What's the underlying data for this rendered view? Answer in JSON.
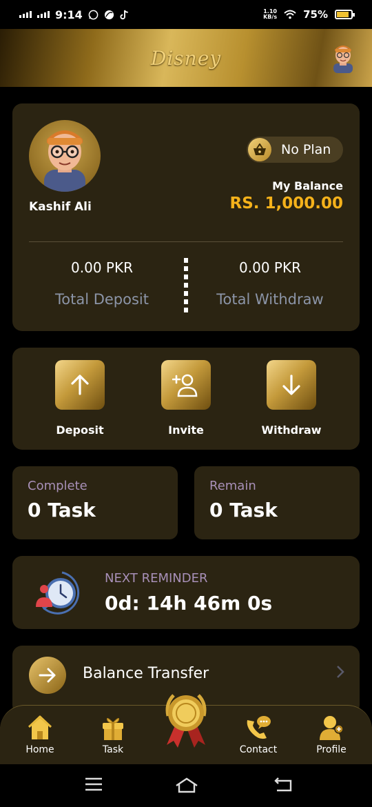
{
  "status_bar": {
    "time": "9:14",
    "net_speed_top": "1.10",
    "net_speed_bottom": "KB/s",
    "battery": "75%",
    "battery_level": 0.75
  },
  "header": {
    "logo_text": "Disney"
  },
  "profile": {
    "user_name": "Kashif Ali",
    "plan_label": "No Plan",
    "balance_label": "My Balance",
    "balance_value": "RS. 1,000.00",
    "deposit_value": "0.00 PKR",
    "deposit_label": "Total Deposit",
    "withdraw_value": "0.00 PKR",
    "withdraw_label": "Total Withdraw"
  },
  "actions": [
    {
      "label": "Deposit",
      "icon": "arrow-up-icon"
    },
    {
      "label": "Invite",
      "icon": "add-user-icon"
    },
    {
      "label": "Withdraw",
      "icon": "arrow-down-icon"
    }
  ],
  "tasks": {
    "complete_label": "Complete",
    "complete_value": "0 Task",
    "remain_label": "Remain",
    "remain_value": "0 Task"
  },
  "reminder": {
    "label": "NEXT REMINDER",
    "time": "0d: 14h 46m 0s"
  },
  "transfer": {
    "label": "Balance Transfer"
  },
  "bottom_nav": [
    {
      "label": "Home",
      "icon": "home-icon"
    },
    {
      "label": "Task",
      "icon": "gift-icon"
    },
    {
      "label": "Contact",
      "icon": "phone-chat-icon"
    },
    {
      "label": "Profile",
      "icon": "profile-add-icon"
    }
  ],
  "colors": {
    "accent_gold": "#f5b21b",
    "card_bg": "#2b2412",
    "muted_label": "#a890b8"
  }
}
